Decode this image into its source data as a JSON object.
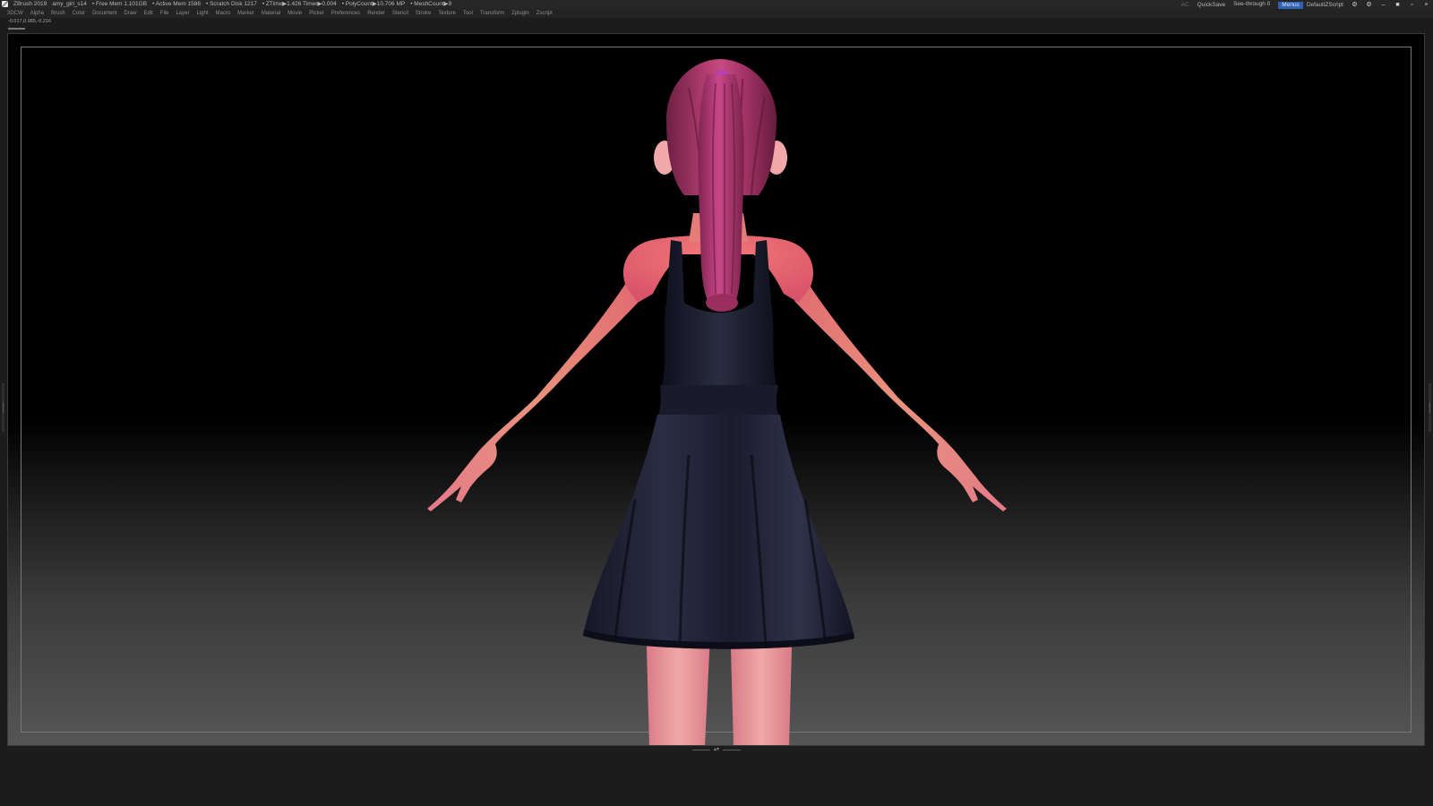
{
  "titlebar": {
    "app": "ZBrush 2019",
    "project": "amy_girl_s14",
    "free_mem": "• Free Mem 1.101GB",
    "active_mem": "• Active Mem 1586",
    "scratch_disk": "• Scratch Disk 1217",
    "ztime": "• ZTime▶1.426 Timer▶0.004",
    "polycount": "• PolyCount▶10.706 MP",
    "meshcount": "• MeshCount▶9",
    "ac": "AC",
    "quicksave": "QuickSave",
    "see_through": "See-through   0",
    "see_through_level": 0,
    "menus_button": "Menus",
    "script": "DefaultZScript",
    "icons": [
      "palette-icon",
      "help-icon",
      "minimize-icon",
      "restore-icon",
      "close-icon"
    ]
  },
  "menubar": {
    "items": [
      "3DCW",
      "Alpha",
      "Brush",
      "Color",
      "Document",
      "Draw",
      "Edit",
      "File",
      "Layer",
      "Light",
      "Macro",
      "Marker",
      "Material",
      "Movie",
      "Picker",
      "Preferences",
      "Render",
      "Stencil",
      "Stroke",
      "Texture",
      "Tool",
      "Transform",
      "Zplugin",
      "Zscript"
    ]
  },
  "status": {
    "coords": "-0.017,0.985,-0.216"
  },
  "viewport": {
    "subject": "character-back-view",
    "colors": {
      "skin": "#e57f83",
      "hair": "#a23565",
      "dress": "#1d1e2e",
      "shirt": "#ef6a6e",
      "background_top": "#000000",
      "background_bottom": "#555555"
    }
  }
}
